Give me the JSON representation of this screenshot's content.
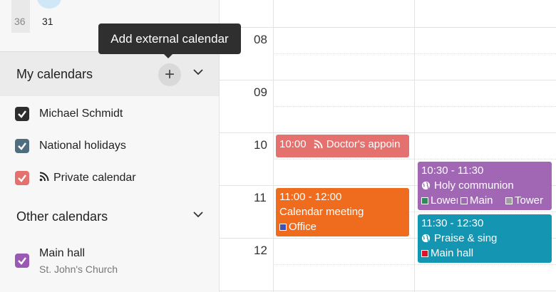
{
  "mini_calendar": {
    "week_number": "36",
    "day": "31"
  },
  "tooltip": "Add external calendar",
  "my_calendars": {
    "title": "My calendars",
    "add_glyph": "+",
    "items": [
      {
        "label": "Michael Schmidt",
        "color": "#2d2d2d",
        "checked": true
      },
      {
        "label": "National holidays",
        "color": "#4f6d7f",
        "checked": true
      },
      {
        "label": "Private calendar",
        "color": "#e4716d",
        "checked": true,
        "icon": "rss-feed-icon"
      }
    ]
  },
  "other_calendars": {
    "title": "Other calendars",
    "items": [
      {
        "label": "Main hall",
        "sublabel": "St. John's Church",
        "color": "#9b59b6",
        "checked": true
      }
    ]
  },
  "day_view": {
    "hours": [
      "08",
      "09",
      "10",
      "11",
      "12"
    ],
    "events": [
      {
        "time": "10:00",
        "title": "Doctor's appoin",
        "color": "#e4716d",
        "icon": "rss-feed-icon"
      },
      {
        "time": "11:00 - 12:00",
        "title": "Calendar meeting",
        "color": "#ef6c1f",
        "locations": [
          {
            "label": "Office",
            "color": "#3f51b5"
          }
        ]
      },
      {
        "time": "10:30 - 11:30",
        "title": "Holy communion",
        "color": "#a167b5",
        "icon": "globe-icon",
        "locations": [
          {
            "label": "Lower",
            "color": "#2e8b57"
          },
          {
            "label": "Main",
            "color": "#a167b5"
          },
          {
            "label": "Tower",
            "color": "#9e9e9e"
          }
        ]
      },
      {
        "time": "11:30 - 12:30",
        "title": "Praise & sing",
        "color": "#1496b3",
        "icon": "globe-icon",
        "locations": [
          {
            "label": "Main hall",
            "color": "#e0102b"
          }
        ]
      }
    ]
  }
}
